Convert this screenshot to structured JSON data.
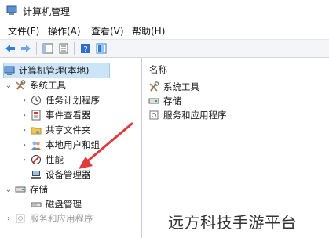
{
  "window": {
    "title": "计算机管理"
  },
  "menu": [
    "文件(F)",
    "操作(A)",
    "查看(V)",
    "帮助(H)"
  ],
  "tree": {
    "root": "计算机管理(本地)",
    "system_tools": "系统工具",
    "task_scheduler": "任务计划程序",
    "event_viewer": "事件查看器",
    "shared_folders": "共享文件夹",
    "local_users": "本地用户和组",
    "performance": "性能",
    "device_manager": "设备管理器",
    "storage": "存储",
    "disk_management": "磁盘管理",
    "services_apps": "服务和应用程序"
  },
  "list": {
    "column_name": "名称",
    "items": [
      "系统工具",
      "存储",
      "服务和应用程序"
    ]
  },
  "watermark": "远方科技手游平台",
  "colors": {
    "selection": "#cce4f7",
    "arrow": "#e23b3b",
    "accent": "#1f6fc5"
  }
}
